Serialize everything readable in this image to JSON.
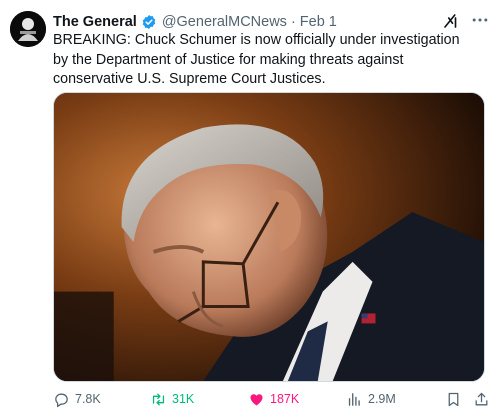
{
  "author": {
    "display_name": "The General",
    "handle": "@GeneralMCNews",
    "separator": "·",
    "date": "Feb 1"
  },
  "tweet": {
    "text": "BREAKING: Chuck Schumer is now officially under investigation by the Department of Justice for making threats against conservative U.S. Supreme Court Justices."
  },
  "media": {
    "description_icon": "photo"
  },
  "actions": {
    "replies": "7.8K",
    "reposts": "31K",
    "likes": "187K",
    "views": "2.9M"
  },
  "colors": {
    "verified": "#1d9bf0",
    "repost": "#00ba7c",
    "like": "#f91880",
    "muted": "#536471"
  },
  "icons": [
    "verified-badge-icon",
    "grok-icon",
    "more-icon",
    "reply-icon",
    "repost-icon",
    "heart-icon",
    "views-icon",
    "bookmark-icon",
    "share-icon"
  ]
}
